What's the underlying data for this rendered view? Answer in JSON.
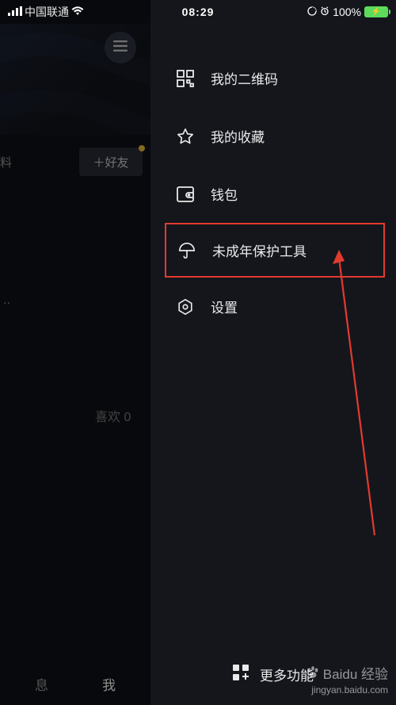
{
  "status": {
    "carrier": "中国联通",
    "time": "08:29",
    "battery_pct": "100%"
  },
  "left": {
    "fragment1": "料",
    "add_friend": "＋好友",
    "dots": "..",
    "likes_label": "喜欢 0",
    "tab_msg": "息",
    "tab_me": "我"
  },
  "menu": {
    "qrcode": "我的二维码",
    "favorites": "我的收藏",
    "wallet": "钱包",
    "youth": "未成年保护工具",
    "settings": "设置",
    "more": "更多功能"
  },
  "watermark": {
    "brand": "Baidu 经验",
    "url": "jingyan.baidu.com"
  }
}
